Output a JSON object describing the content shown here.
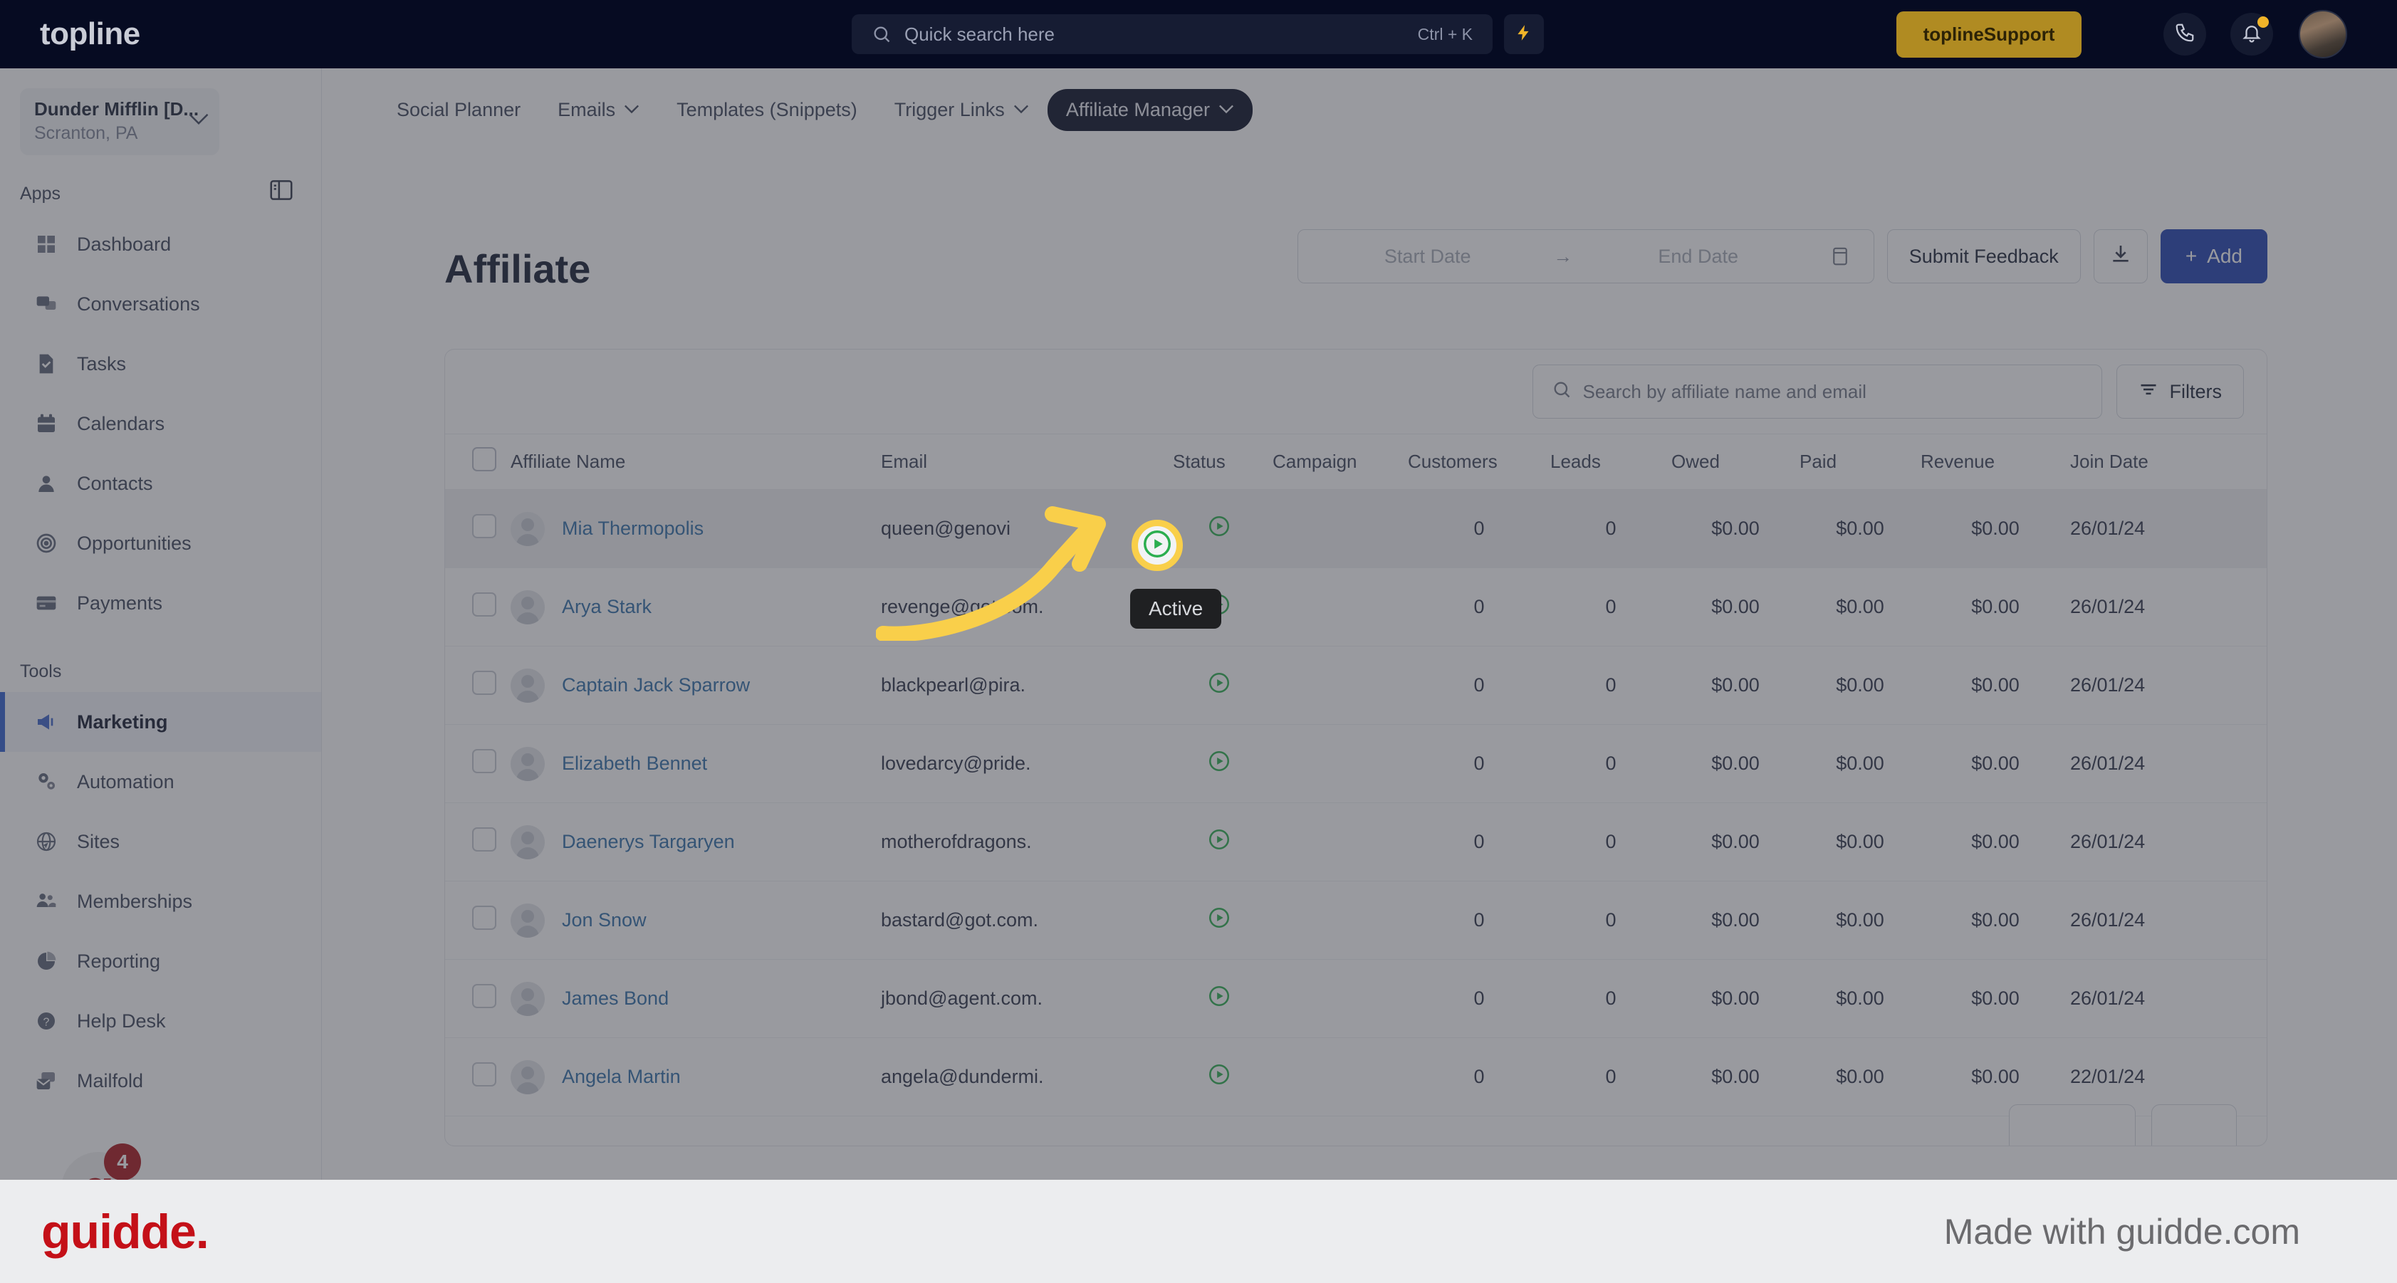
{
  "topbar": {
    "logo": "topline",
    "search_placeholder": "Quick search here",
    "search_shortcut": "Ctrl + K",
    "bolt_icon": "lightning-bolt-icon",
    "support_brand": "topline",
    "support_label": " Support",
    "call_icon": "phone-icon",
    "bell_icon": "bell-icon",
    "avatar": "user-avatar"
  },
  "sidebar": {
    "workspace_name": "Dunder Mifflin [D...",
    "workspace_location": "Scranton, PA",
    "panel_toggle_icon": "sidebar-toggle-icon",
    "sections": [
      {
        "label": "Apps",
        "items": [
          {
            "label": "Dashboard",
            "icon": "dashboard-icon",
            "active": false
          },
          {
            "label": "Conversations",
            "icon": "chat-icon",
            "active": false
          },
          {
            "label": "Tasks",
            "icon": "task-check-icon",
            "active": false
          },
          {
            "label": "Calendars",
            "icon": "calendar-icon",
            "active": false
          },
          {
            "label": "Contacts",
            "icon": "person-icon",
            "active": false
          },
          {
            "label": "Opportunities",
            "icon": "target-icon",
            "active": false
          },
          {
            "label": "Payments",
            "icon": "credit-card-icon",
            "active": false
          }
        ]
      },
      {
        "label": "Tools",
        "items": [
          {
            "label": "Marketing",
            "icon": "megaphone-icon",
            "active": true
          },
          {
            "label": "Automation",
            "icon": "gears-icon",
            "active": false
          },
          {
            "label": "Sites",
            "icon": "globe-cursor-icon",
            "active": false
          },
          {
            "label": "Memberships",
            "icon": "people-add-icon",
            "active": false
          },
          {
            "label": "Reporting",
            "icon": "pie-chart-icon",
            "active": false
          },
          {
            "label": "Help Desk",
            "icon": "question-circle-icon",
            "active": false
          },
          {
            "label": "Mailfold",
            "icon": "mail-stack-icon",
            "active": false
          }
        ]
      }
    ],
    "guidde_fab_letter": "g",
    "guidde_badge_count": "4"
  },
  "subnav": {
    "items": [
      {
        "label": "Social Planner",
        "has_chevron": false,
        "active": false
      },
      {
        "label": "Emails",
        "has_chevron": true,
        "active": false
      },
      {
        "label": "Templates (Snippets)",
        "has_chevron": false,
        "active": false
      },
      {
        "label": "Trigger Links",
        "has_chevron": true,
        "active": false
      },
      {
        "label": "Affiliate Manager",
        "has_chevron": true,
        "active": true
      }
    ],
    "chevron_glyph": "⌄"
  },
  "page": {
    "title": "Affiliate",
    "date_start_placeholder": "Start Date",
    "date_arrow": "→",
    "date_end_placeholder": "End Date",
    "calendar_icon": "calendar-icon",
    "submit_feedback_label": "Submit Feedback",
    "download_icon": "download-icon",
    "add_label": "Add",
    "add_plus": "+"
  },
  "toolbar": {
    "search_placeholder": "Search by affiliate name and email",
    "search_icon": "search-icon",
    "filters_label": "Filters",
    "filters_icon": "filter-icon"
  },
  "table": {
    "headers": [
      "Affiliate Name",
      "Email",
      "Status",
      "Campaign",
      "Customers",
      "Leads",
      "Owed",
      "Paid",
      "Revenue",
      "Join Date"
    ],
    "rows": [
      {
        "name": "Mia Thermopolis",
        "email": "queen@genovi",
        "status": "active",
        "campaign": "",
        "customers": "0",
        "leads": "0",
        "owed": "$0.00",
        "paid": "$0.00",
        "revenue": "$0.00",
        "join": "26/01/24",
        "highlighted": true
      },
      {
        "name": "Arya Stark",
        "email": "revenge@got.com.",
        "status": "active",
        "campaign": "",
        "customers": "0",
        "leads": "0",
        "owed": "$0.00",
        "paid": "$0.00",
        "revenue": "$0.00",
        "join": "26/01/24",
        "highlighted": false
      },
      {
        "name": "Captain Jack Sparrow",
        "email": "blackpearl@pira.",
        "status": "active",
        "campaign": "",
        "customers": "0",
        "leads": "0",
        "owed": "$0.00",
        "paid": "$0.00",
        "revenue": "$0.00",
        "join": "26/01/24",
        "highlighted": false
      },
      {
        "name": "Elizabeth Bennet",
        "email": "lovedarcy@pride.",
        "status": "active",
        "campaign": "",
        "customers": "0",
        "leads": "0",
        "owed": "$0.00",
        "paid": "$0.00",
        "revenue": "$0.00",
        "join": "26/01/24",
        "highlighted": false
      },
      {
        "name": "Daenerys Targaryen",
        "email": "motherofdragons.",
        "status": "active",
        "campaign": "",
        "customers": "0",
        "leads": "0",
        "owed": "$0.00",
        "paid": "$0.00",
        "revenue": "$0.00",
        "join": "26/01/24",
        "highlighted": false
      },
      {
        "name": "Jon Snow",
        "email": "bastard@got.com.",
        "status": "active",
        "campaign": "",
        "customers": "0",
        "leads": "0",
        "owed": "$0.00",
        "paid": "$0.00",
        "revenue": "$0.00",
        "join": "26/01/24",
        "highlighted": false
      },
      {
        "name": "James Bond",
        "email": "jbond@agent.com.",
        "status": "active",
        "campaign": "",
        "customers": "0",
        "leads": "0",
        "owed": "$0.00",
        "paid": "$0.00",
        "revenue": "$0.00",
        "join": "26/01/24",
        "highlighted": false
      },
      {
        "name": "Angela Martin",
        "email": "angela@dundermi.",
        "status": "active",
        "campaign": "",
        "customers": "0",
        "leads": "0",
        "owed": "$0.00",
        "paid": "$0.00",
        "revenue": "$0.00",
        "join": "22/01/24",
        "highlighted": false
      }
    ]
  },
  "callout": {
    "tooltip_text": "Active",
    "status_icon": "play-circle-icon",
    "highlight_color": "#f9cf4a",
    "status_color": "#2bae4f"
  },
  "footer": {
    "logo": "guidde.",
    "made_with": "Made with guidde.com"
  }
}
